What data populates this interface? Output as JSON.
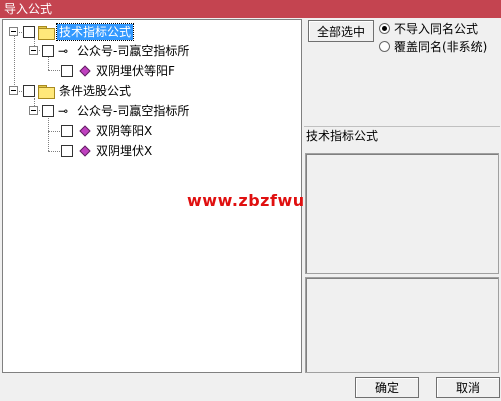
{
  "window": {
    "title": "导入公式"
  },
  "tree": {
    "root1": {
      "label": "技术指标公式",
      "child": {
        "label": "公众号-司蠃空指标所",
        "items": [
          {
            "label": "双阴埋伏等阳F"
          }
        ]
      }
    },
    "root2": {
      "label": "条件选股公式",
      "child": {
        "label": "公众号-司蠃空指标所",
        "items": [
          {
            "label": "双阴等阳X"
          },
          {
            "label": "双阴埋伏X"
          }
        ]
      }
    }
  },
  "watermark": "www.zbzfwu.com",
  "options": {
    "select_all": "全部选中",
    "radio_skip": "不导入同名公式",
    "radio_overwrite": "覆盖同名(非系统)",
    "selected": "radio_skip"
  },
  "info": {
    "category": "技术指标公式"
  },
  "buttons": {
    "ok": "确定",
    "cancel": "取消"
  },
  "colors": {
    "titlebar": "#c44450",
    "selection": "#3399ff",
    "watermark": "#e01010",
    "bullet": "#c040c0"
  }
}
